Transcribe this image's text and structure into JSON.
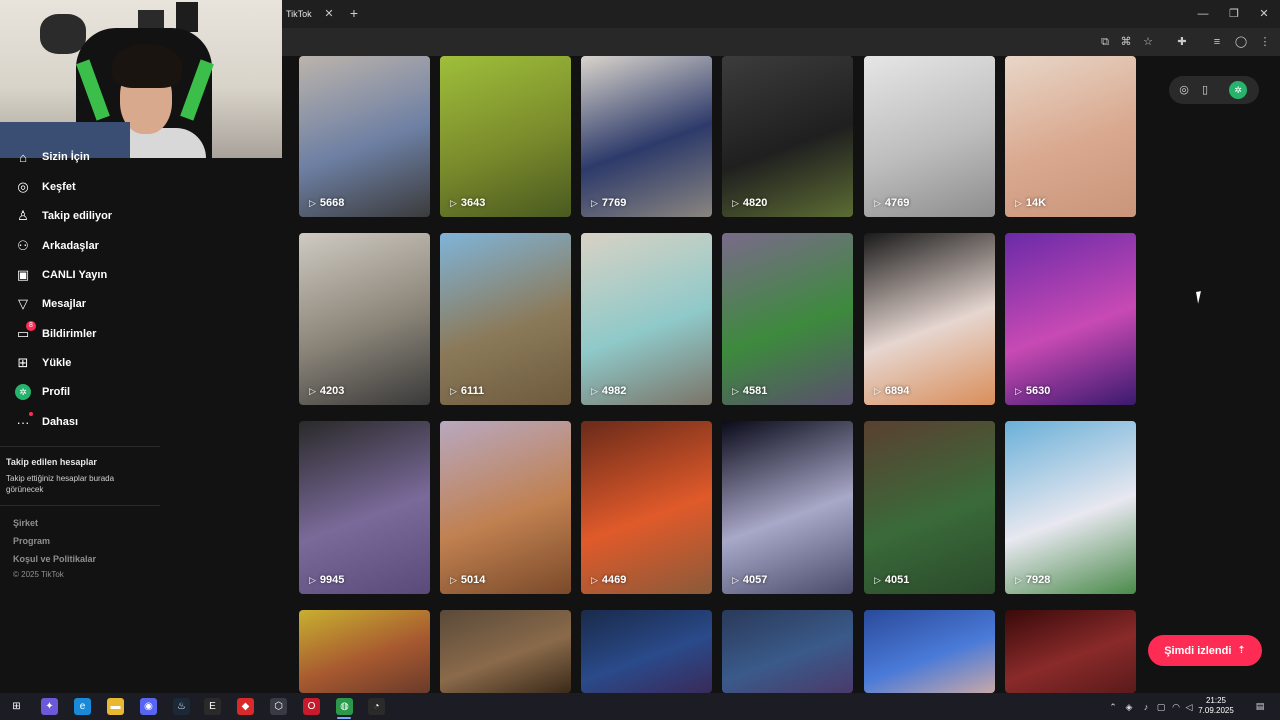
{
  "browser": {
    "tab_title": "TikTok",
    "tab_close": "✕",
    "new_tab": "+",
    "window_controls": {
      "minimize": "—",
      "restore": "❐",
      "close": "✕"
    }
  },
  "sidebar": {
    "items": [
      {
        "label": "Sizin İçin",
        "icon": "home-icon",
        "glyph": "⌂"
      },
      {
        "label": "Keşfet",
        "icon": "compass-icon",
        "glyph": "◎"
      },
      {
        "label": "Takip ediliyor",
        "icon": "person-add-icon",
        "glyph": "♙"
      },
      {
        "label": "Arkadaşlar",
        "icon": "friends-icon",
        "glyph": "⚇"
      },
      {
        "label": "CANLI Yayın",
        "icon": "live-tv-icon",
        "glyph": "▣"
      },
      {
        "label": "Mesajlar",
        "icon": "send-icon",
        "glyph": "▽"
      },
      {
        "label": "Bildirimler",
        "icon": "notification-icon",
        "glyph": "▭",
        "badge": "8"
      },
      {
        "label": "Yükle",
        "icon": "upload-icon",
        "glyph": "⊞"
      },
      {
        "label": "Profil",
        "icon": "profile-avatar-icon",
        "glyph": "✲"
      },
      {
        "label": "Dahası",
        "icon": "more-icon",
        "glyph": "···"
      }
    ],
    "following_title": "Takip edilen hesaplar",
    "following_desc": "Takip ettiğiniz hesaplar burada görünecek",
    "footer_links": [
      "Şirket",
      "Program",
      "Koşul ve Politikalar"
    ],
    "copyright": "© 2025 TikTok"
  },
  "grid": {
    "play_glyph": "▷",
    "videos": [
      {
        "views": "5668",
        "colors": [
          "#bcb4ac",
          "#6d7fa3",
          "#3b3b3b"
        ]
      },
      {
        "views": "3643",
        "colors": [
          "#9fbf3a",
          "#7a8b2c",
          "#4a5a20"
        ]
      },
      {
        "views": "7769",
        "colors": [
          "#d9d4cc",
          "#2d3a6a",
          "#8a8580"
        ]
      },
      {
        "views": "4820",
        "colors": [
          "#3c3c3c",
          "#1f1f1f",
          "#5c6c34"
        ]
      },
      {
        "views": "4769",
        "colors": [
          "#e6e6e6",
          "#bdbdbd",
          "#8d8d8d"
        ]
      },
      {
        "views": "14K",
        "colors": [
          "#e8d6c8",
          "#d9a88e",
          "#c9957b"
        ]
      },
      {
        "views": "4203",
        "colors": [
          "#cfcac2",
          "#8a8478",
          "#3a3a3a"
        ]
      },
      {
        "views": "6111",
        "colors": [
          "#7fb4d9",
          "#8b7a5a",
          "#6e5a3e"
        ]
      },
      {
        "views": "4982",
        "colors": [
          "#d8d2c4",
          "#8fc9c9",
          "#7a7468"
        ]
      },
      {
        "views": "4581",
        "colors": [
          "#7a6a8a",
          "#3d8a3d",
          "#5a4f6e"
        ]
      },
      {
        "views": "6894",
        "colors": [
          "#1a1a1a",
          "#e6d6d0",
          "#d98e5a"
        ]
      },
      {
        "views": "5630",
        "colors": [
          "#6a2aa8",
          "#c84ab4",
          "#3a1a6e"
        ]
      },
      {
        "views": "9945",
        "colors": [
          "#2a2a2a",
          "#7a6a9a",
          "#5a4a7a"
        ]
      },
      {
        "views": "5014",
        "colors": [
          "#b8a8c0",
          "#c08050",
          "#7a4a2a"
        ]
      },
      {
        "views": "4469",
        "colors": [
          "#6a2a1a",
          "#e05a2a",
          "#8a5a3a"
        ]
      },
      {
        "views": "4057",
        "colors": [
          "#0a0a1a",
          "#a8a8c8",
          "#4a4a6a"
        ]
      },
      {
        "views": "4051",
        "colors": [
          "#5a4030",
          "#3a6a3a",
          "#2a4a2a"
        ]
      },
      {
        "views": "7928",
        "colors": [
          "#6ab0d8",
          "#e8e8f0",
          "#4a8a4a"
        ]
      },
      {
        "views": "",
        "colors": [
          "#c8b030",
          "#a85a30",
          "#6a3a2a"
        ]
      },
      {
        "views": "",
        "colors": [
          "#5a4a3a",
          "#8a6a4a",
          "#3a2a1a"
        ]
      },
      {
        "views": "",
        "colors": [
          "#1a2a4a",
          "#2a4a8a",
          "#3a2a5a"
        ]
      },
      {
        "views": "",
        "colors": [
          "#2a3a5a",
          "#3a5a8a",
          "#4a3a6a"
        ]
      },
      {
        "views": "",
        "colors": [
          "#2a4a9a",
          "#4a7ad8",
          "#c8a8a8"
        ]
      },
      {
        "views": "",
        "colors": [
          "#3a0a0a",
          "#8a2a2a",
          "#5a1a1a"
        ]
      }
    ]
  },
  "right_actions": {
    "icons": [
      "compass-small-icon",
      "device-icon"
    ]
  },
  "watched_button": {
    "label": "Şimdi izlendi",
    "arrow": "⇡"
  },
  "taskbar": {
    "time": "21:25",
    "date": "7.09.2025",
    "apps": [
      {
        "name": "start-menu-icon",
        "glyph": "⊞",
        "color": "#1c1c24"
      },
      {
        "name": "copilot-icon",
        "glyph": "✦",
        "color": "#6a5ad8"
      },
      {
        "name": "edge-icon",
        "glyph": "e",
        "color": "#1a8ad8"
      },
      {
        "name": "file-explorer-icon",
        "glyph": "▬",
        "color": "#e8b830"
      },
      {
        "name": "discord-icon",
        "glyph": "◉",
        "color": "#5865f2"
      },
      {
        "name": "steam-icon",
        "glyph": "♨",
        "color": "#1b2838"
      },
      {
        "name": "epic-games-icon",
        "glyph": "E",
        "color": "#2a2a2a"
      },
      {
        "name": "red-app-icon",
        "glyph": "◆",
        "color": "#d82a2a"
      },
      {
        "name": "cube-app-icon",
        "glyph": "⬡",
        "color": "#3a3a44"
      },
      {
        "name": "opera-icon",
        "glyph": "O",
        "color": "#c81a2a"
      },
      {
        "name": "chrome-icon",
        "glyph": "◍",
        "color": "#2a9a4a"
      },
      {
        "name": "recorder-icon",
        "glyph": "◔",
        "color": "#2a2a2a"
      }
    ]
  }
}
